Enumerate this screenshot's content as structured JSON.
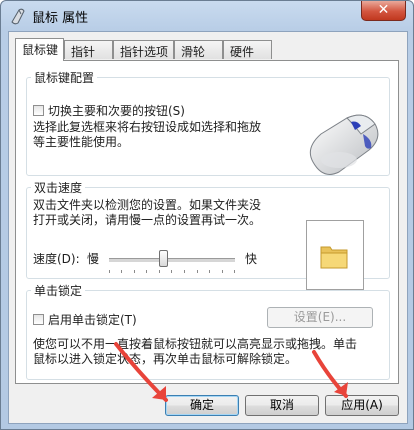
{
  "window": {
    "title": "鼠标 属性",
    "close_label": "✕"
  },
  "tabs": [
    {
      "label": "鼠标键",
      "active": true
    },
    {
      "label": "指针"
    },
    {
      "label": "指针选项"
    },
    {
      "label": "滑轮"
    },
    {
      "label": "硬件"
    }
  ],
  "button_config": {
    "legend": "鼠标键配置",
    "checkbox_label": "切换主要和次要的按钮(S)",
    "checked": false,
    "description_line1": "选择此复选框来将右按钮设成如选择和拖放",
    "description_line2": "等主要性能使用。"
  },
  "double_click": {
    "legend": "双击速度",
    "description_line1": "双击文件夹以检测您的设置。如果文件夹没",
    "description_line2": "打开或关闭，请用慢一点的设置再试一次。",
    "speed_label": "速度(D):",
    "slow_label": "慢",
    "fast_label": "快",
    "speed_level": 0.4
  },
  "click_lock": {
    "legend": "单击锁定",
    "checkbox_label": "启用单击锁定(T)",
    "checked": false,
    "settings_button": "设置(E)...",
    "description_line1": "使您可以不用一直按着鼠标按钮就可以高亮显示或拖拽。单击",
    "description_line2": "鼠标以进入锁定状态，再次单击鼠标可解除锁定。"
  },
  "footer": {
    "ok": "确定",
    "cancel": "取消",
    "apply": "应用(A)"
  },
  "colors": {
    "annotation_arrow": "#e8443a",
    "close_button": "#c7452d"
  },
  "icons": [
    "mouse-icon",
    "folder-icon",
    "close-icon"
  ]
}
